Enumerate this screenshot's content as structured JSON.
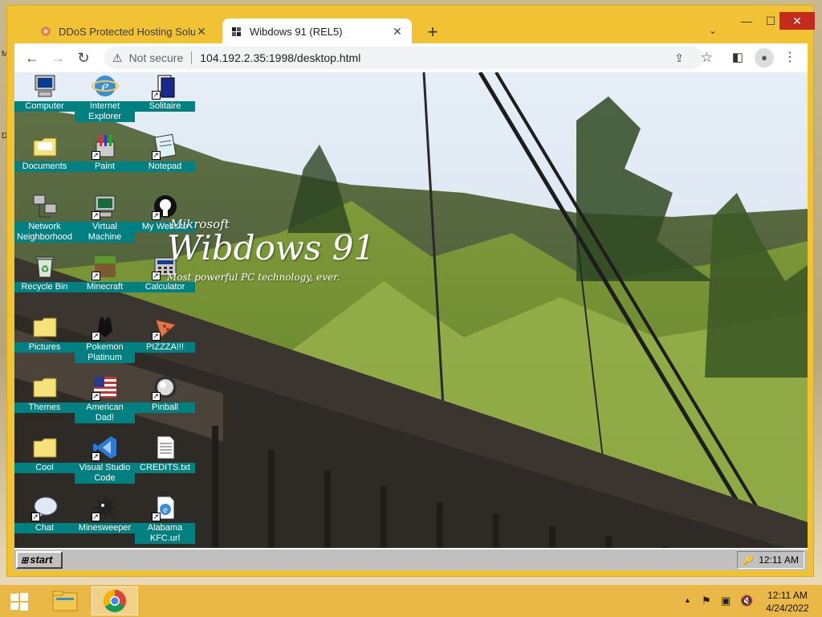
{
  "host": {
    "edge_labels": [
      "M",
      "D"
    ]
  },
  "browser": {
    "tabs": [
      {
        "title": "DDoS Protected Hosting Solution",
        "favicon": "flower-icon"
      },
      {
        "title": "Wibdows 91 (REL5)",
        "favicon": "wibdows-logo-icon"
      }
    ],
    "new_tab": "+",
    "tab_search": "⌄",
    "window_controls": {
      "minimize": "—",
      "maximize": "☐",
      "close": "✕"
    },
    "toolbar": {
      "back": "←",
      "forward": "→",
      "reload": "↻",
      "security_label": "Not secure",
      "url": "104.192.2.35:1998/desktop.html"
    }
  },
  "desktop": {
    "icons": [
      {
        "label": "Computer",
        "icon": "computer-icon",
        "shortcut": false
      },
      {
        "label": "Internet Explorer",
        "icon": "ie-icon",
        "shortcut": false
      },
      {
        "label": "Solitaire",
        "icon": "solitaire-icon",
        "shortcut": true
      },
      {
        "label": "Documents",
        "icon": "documents-folder-icon",
        "shortcut": false
      },
      {
        "label": "Paint",
        "icon": "paint-icon",
        "shortcut": true
      },
      {
        "label": "Notepad",
        "icon": "notepad-icon",
        "shortcut": true
      },
      {
        "label": "Network Neighborhood",
        "icon": "network-icon",
        "shortcut": false
      },
      {
        "label": "Virtual Machine",
        "icon": "virtual-machine-icon",
        "shortcut": true
      },
      {
        "label": "My Website",
        "icon": "github-icon",
        "shortcut": true
      },
      {
        "label": "Recycle Bin",
        "icon": "recycle-bin-icon",
        "shortcut": false
      },
      {
        "label": "Minecraft",
        "icon": "minecraft-icon",
        "shortcut": true
      },
      {
        "label": "Calculator",
        "icon": "calculator-icon",
        "shortcut": true
      },
      {
        "label": "Pictures",
        "icon": "folder-icon",
        "shortcut": false
      },
      {
        "label": "Pokemon Platinum",
        "icon": "pokemon-icon",
        "shortcut": true
      },
      {
        "label": "PIZZZA!!!",
        "icon": "pizza-icon",
        "shortcut": true
      },
      {
        "label": "Themes",
        "icon": "folder-icon",
        "shortcut": false
      },
      {
        "label": "American Dad!",
        "icon": "flag-icon",
        "shortcut": true
      },
      {
        "label": "Pinball",
        "icon": "pinball-icon",
        "shortcut": true
      },
      {
        "label": "Cool",
        "icon": "folder-icon",
        "shortcut": false
      },
      {
        "label": "Visual Studio Code",
        "icon": "vscode-icon",
        "shortcut": true
      },
      {
        "label": "CREDITS.txt",
        "icon": "text-file-icon",
        "shortcut": false
      },
      {
        "label": "Chat",
        "icon": "chat-icon",
        "shortcut": true
      },
      {
        "label": "Minesweeper",
        "icon": "minesweeper-icon",
        "shortcut": true
      },
      {
        "label": "Alabama KFC.url",
        "icon": "url-file-icon",
        "shortcut": true
      }
    ],
    "brand": {
      "company": "Mikrosoft",
      "product": "Wibdows 91",
      "tagline": "Most powerful PC technology, ever."
    },
    "taskbar": {
      "start_label": "start",
      "time": "12:11 AM"
    }
  },
  "host_taskbar": {
    "time": "12:11 AM",
    "date": "4/24/2022"
  },
  "colors": {
    "chrome_frame": "#f1c233",
    "icon_label_bg": "#008080",
    "host_taskbar": "#e9b847",
    "close_button": "#c42b1c"
  }
}
